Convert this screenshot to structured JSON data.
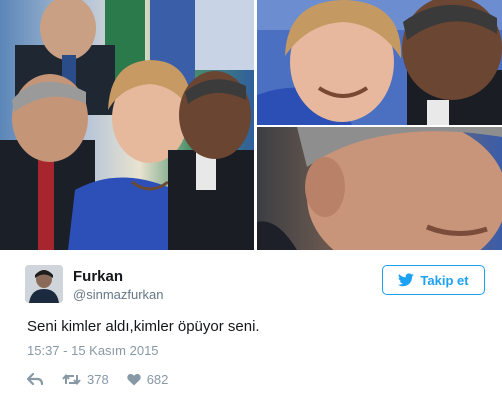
{
  "photos": [
    {
      "subject": "three leaders at a summit; one kisses the woman's cheek"
    },
    {
      "subject": "close-up of the woman smiling while being kissed on the cheek"
    },
    {
      "subject": "close-up of a man watching from the side"
    }
  ],
  "tweet": {
    "name": "Furkan",
    "handle": "@sinmazfurkan",
    "follow_label": "Takip et",
    "text": "Seni kimler aldı,kimler öpüyor seni.",
    "timestamp": "15:37 - 15 Kasım 2015",
    "retweets": "378",
    "likes": "682"
  },
  "icons": {
    "follow": "bird-icon",
    "reply": "reply-icon",
    "retweet": "retweet-icon",
    "like": "heart-icon"
  },
  "colors": {
    "accent": "#1da1f2",
    "name": "#14171a",
    "muted": "#8899a6"
  }
}
